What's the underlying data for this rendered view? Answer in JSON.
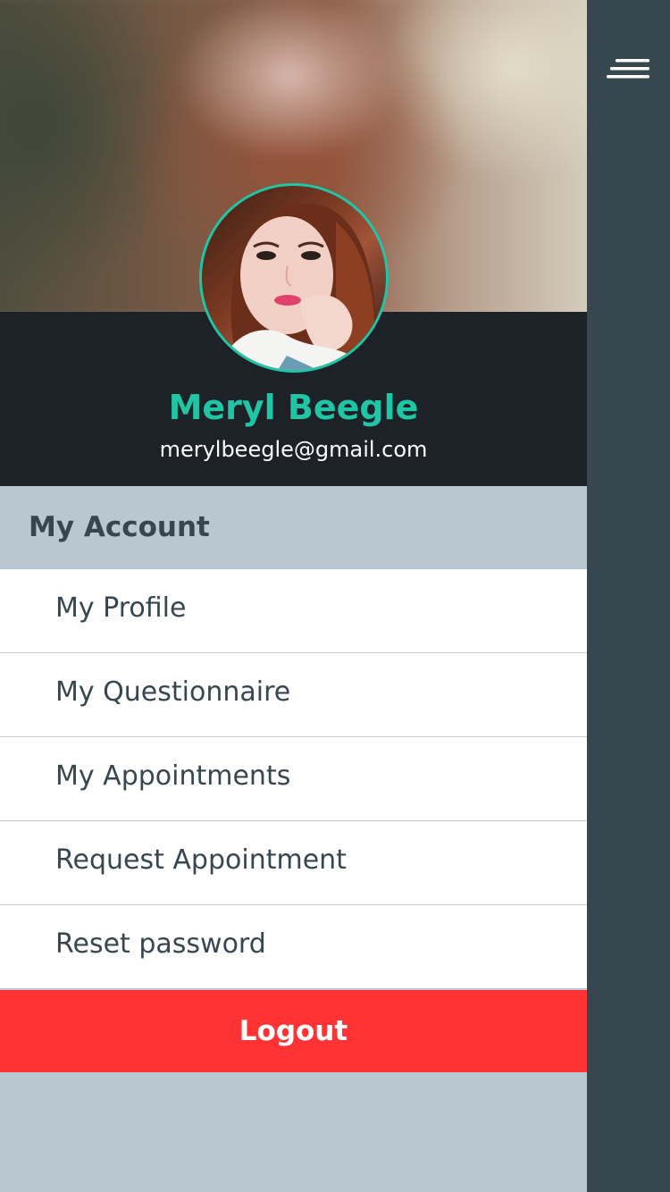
{
  "user": {
    "name": "Meryl Beegle",
    "email": "merylbeegle@gmail.com"
  },
  "section": {
    "title": "My Account"
  },
  "menu": {
    "items": [
      {
        "label": "My Profile"
      },
      {
        "label": "My Questionnaire"
      },
      {
        "label": "My Appointments"
      },
      {
        "label": "Request Appointment"
      },
      {
        "label": "Reset password"
      }
    ]
  },
  "logout": {
    "label": "Logout"
  },
  "colors": {
    "accent": "#1fc5a4",
    "danger": "#ff3333",
    "dark": "#1c2227",
    "rail": "#37474f",
    "section_bg": "#b9c8d0"
  },
  "icons": {
    "menu_toggle": "hamburger-menu-icon"
  }
}
